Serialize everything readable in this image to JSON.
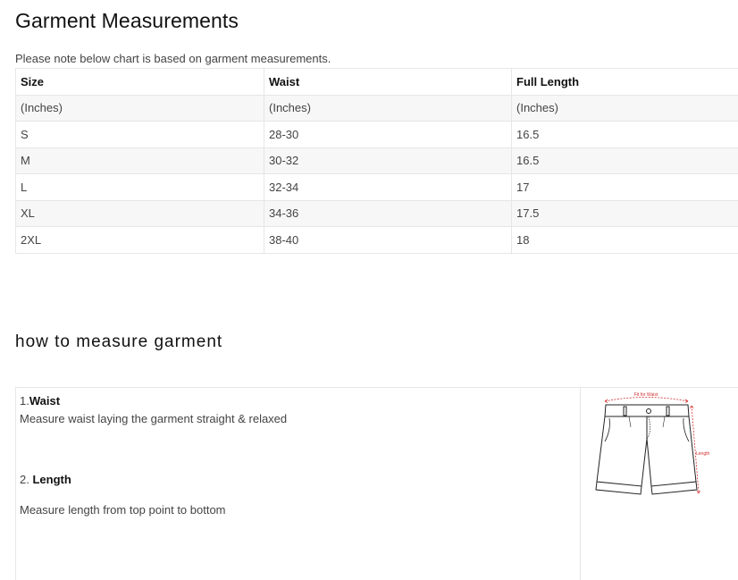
{
  "title": "Garment Measurements",
  "note": "Please note below chart is based on garment measurements.",
  "table": {
    "header": [
      "Size",
      "Waist",
      "Full Length"
    ],
    "rows": [
      [
        "(Inches)",
        "(Inches)",
        "(Inches)"
      ],
      [
        "S",
        "28-30",
        "16.5"
      ],
      [
        "M",
        "30-32",
        "16.5"
      ],
      [
        "L",
        "32-34",
        "17"
      ],
      [
        "XL",
        "34-36",
        "17.5"
      ],
      [
        "2XL",
        "38-40",
        "18"
      ]
    ]
  },
  "how_to": {
    "title": "how to measure garment",
    "step1_num": "1.",
    "step1_label": "Waist",
    "step1_desc": "Measure waist laying the garment straight & relaxed",
    "step2_num": "2. ",
    "step2_label": "Length",
    "step2_desc": "Measure length from top point to bottom",
    "diagram_waist_label": "Fit for Waist",
    "diagram_length_label": "Length",
    "accent_color": "#d32f2f"
  }
}
